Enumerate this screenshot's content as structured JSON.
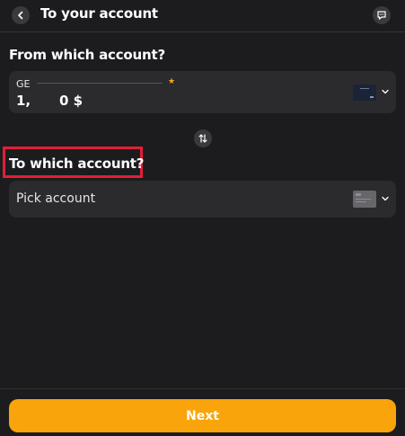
{
  "header": {
    "title": "To your account",
    "back_icon": "chevron-left-icon",
    "chat_icon": "chat-icon"
  },
  "from_section": {
    "title": "From which account?",
    "account": {
      "prefix": "GE",
      "favorite_icon": "star-icon",
      "balance_start": "1,",
      "balance_end": "0 $",
      "card_icon": "card-thumbnail-icon"
    }
  },
  "swap_icon": "swap-arrows-icon",
  "to_section": {
    "title": "To which account?",
    "placeholder": "Pick account",
    "card_icon": "card-thumbnail-icon"
  },
  "footer": {
    "next_label": "Next"
  },
  "colors": {
    "background": "#1c1c1e",
    "card": "#2b2b2d",
    "accent": "#f9a40a",
    "highlight": "#e31e38",
    "star": "#f5a623"
  }
}
